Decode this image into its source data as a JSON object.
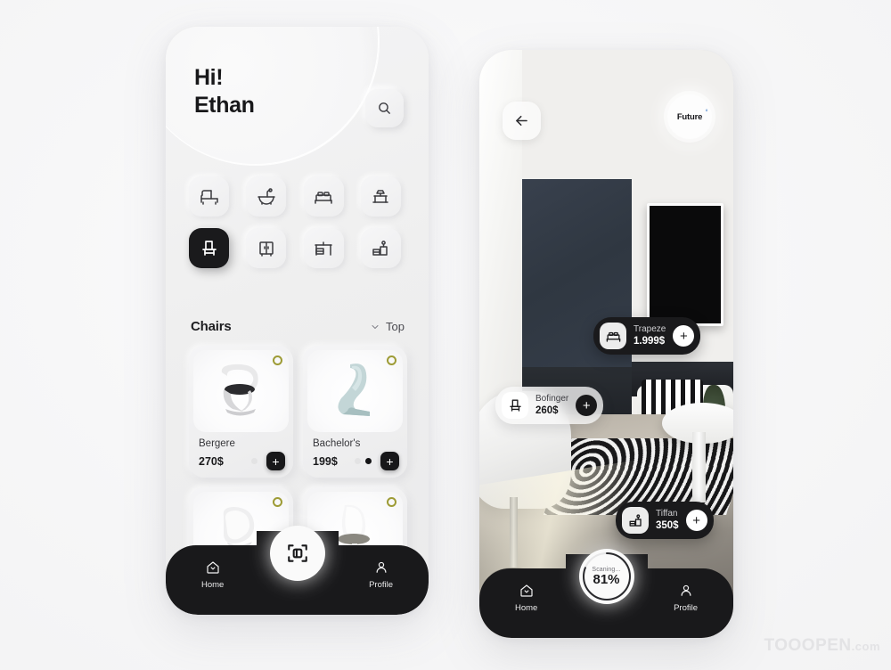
{
  "app": {
    "background_color": "#f8f8f9",
    "accent_dark": "#18181a",
    "favorite_ring_color": "#9d9b35"
  },
  "left_screen": {
    "greeting_line1": "Hi!",
    "greeting_line2": "Ethan",
    "search_icon": "search-icon",
    "categories": [
      {
        "id": "sofa",
        "icon": "sofa-icon",
        "active": false
      },
      {
        "id": "bathtub",
        "icon": "bathtub-icon",
        "active": false
      },
      {
        "id": "bed",
        "icon": "bed-icon",
        "active": false
      },
      {
        "id": "table",
        "icon": "table-lamp-icon",
        "active": false
      },
      {
        "id": "chair",
        "icon": "chair-icon",
        "active": true
      },
      {
        "id": "wardrobe",
        "icon": "wardrobe-icon",
        "active": false
      },
      {
        "id": "desk",
        "icon": "desk-icon",
        "active": false
      },
      {
        "id": "nightstand",
        "icon": "nightstand-icon",
        "active": false
      }
    ],
    "section": {
      "title": "Chairs",
      "sort_icon": "chevron-down-icon",
      "sort_label": "Top"
    },
    "products": [
      {
        "name": "Bergere",
        "price": "270$",
        "dots": [
          "light"
        ],
        "add_label": "+"
      },
      {
        "name": "Bachelor's",
        "price": "199$",
        "dots": [
          "light",
          "dark"
        ],
        "add_label": "+"
      },
      {
        "name": "",
        "price": "",
        "dots": [],
        "add_label": "+"
      },
      {
        "name": "",
        "price": "",
        "dots": [],
        "add_label": "+"
      }
    ],
    "nav": {
      "home_label": "Home",
      "home_icon": "home-icon",
      "center_icon": "ar-scan-icon",
      "profile_label": "Profile",
      "profile_icon": "person-icon"
    }
  },
  "right_screen": {
    "back_icon": "arrow-left-icon",
    "logo_text": "Future",
    "logo_sup": "°",
    "tags": [
      {
        "name": "Trapeze",
        "price": "1.999$",
        "icon": "bed-icon",
        "style": "dark",
        "add_label": "+"
      },
      {
        "name": "Bofinger",
        "price": "260$",
        "icon": "chair-icon",
        "style": "light",
        "add_label": "+"
      },
      {
        "name": "Tiffan",
        "price": "350$",
        "icon": "nightstand-icon",
        "style": "dark",
        "add_label": "+"
      }
    ],
    "nav": {
      "home_label": "Home",
      "home_icon": "home-icon",
      "profile_label": "Profile",
      "profile_icon": "person-icon",
      "scan_label": "Scaning...",
      "scan_percent": "81%",
      "scan_progress": 81
    }
  },
  "watermark": {
    "text": "TOOOPEN",
    "suffix": ".com"
  }
}
